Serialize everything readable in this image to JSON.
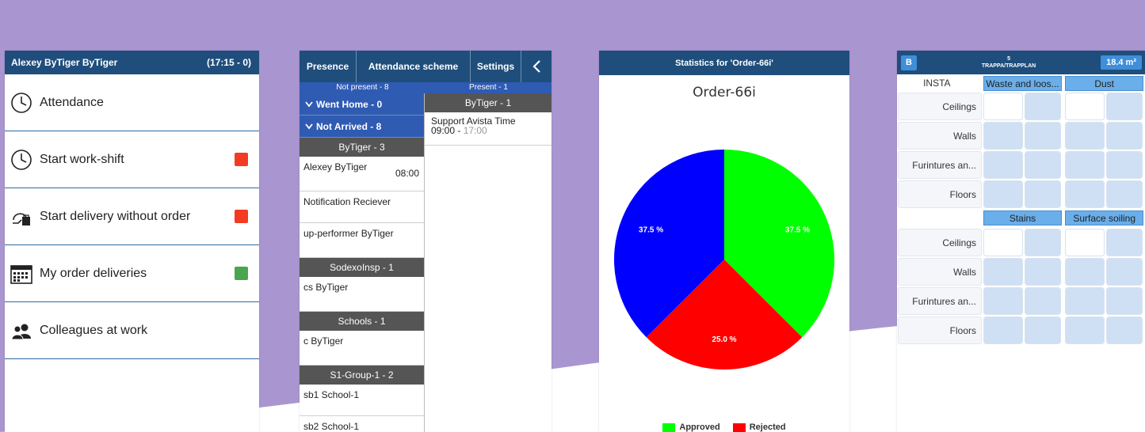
{
  "colors": {
    "header": "#1f4e7c",
    "red": "#f23b22",
    "green": "#4aa64e",
    "blue_group": "#2f5bb3"
  },
  "screen1": {
    "header_name": "Alexey ByTiger ByTiger",
    "header_time": "(17:15 - 0)",
    "items": [
      {
        "label": "Attendance",
        "icon": "clock-icon",
        "status": null
      },
      {
        "label": "Start work-shift",
        "icon": "clock-icon",
        "status": "red"
      },
      {
        "label": "Start delivery without order",
        "icon": "delivery-icon",
        "status": "red"
      },
      {
        "label": "My order deliveries",
        "icon": "calendar-icon",
        "status": "green"
      },
      {
        "label": "Colleagues at work",
        "icon": "people-icon",
        "status": null
      }
    ]
  },
  "screen2": {
    "tabs": [
      "Presence",
      "Attendance scheme",
      "Settings"
    ],
    "back_icon": "chevron-left-icon",
    "not_present": "Not present - 8",
    "present": "Present - 1",
    "went_home": "Went Home - 0",
    "not_arrived": "Not Arrived - 8",
    "left_sections": [
      {
        "title": "ByTiger - 3",
        "people": [
          {
            "name": "Alexey ByTiger",
            "time": "08:00"
          },
          {
            "name": "Notification Reciever",
            "time": ""
          },
          {
            "name": "up-performer ByTiger",
            "time": ""
          }
        ]
      },
      {
        "title": "SodexoInsp - 1",
        "people": [
          {
            "name": "cs ByTiger",
            "time": ""
          }
        ]
      },
      {
        "title": "Schools - 1",
        "people": [
          {
            "name": "c ByTiger",
            "time": ""
          }
        ]
      },
      {
        "title": "S1-Group-1 - 2",
        "people": [
          {
            "name": "sb1 School-1",
            "time": ""
          },
          {
            "name": "sb2 School-1",
            "time": ""
          }
        ]
      }
    ],
    "right_section": "ByTiger - 1",
    "right_entry": {
      "name": "Support Avista Time",
      "start": "09:00",
      "sep": " - ",
      "end": "17:00"
    }
  },
  "screen3": {
    "header": "Statistics for 'Order-66i'",
    "title": "Order-66i",
    "legend": [
      {
        "label": "Approved",
        "color": "#00ff00"
      },
      {
        "label": "Rejected",
        "color": "#ff0000"
      }
    ]
  },
  "chart_data": {
    "type": "pie",
    "title": "Order-66i",
    "slices": [
      {
        "label": "Approved",
        "value": 37.5,
        "color": "#00ff00",
        "text": "37.5 %"
      },
      {
        "label": "Rejected",
        "value": 25.0,
        "color": "#ff0000",
        "text": "25.0 %"
      },
      {
        "label": "",
        "value": 37.5,
        "color": "#0000ff",
        "text": "37.5 %"
      }
    ],
    "legend_entries": [
      "Approved",
      "Rejected"
    ],
    "legend_position": "bottom"
  },
  "screen4": {
    "button_b": "B",
    "top_number": "5",
    "top_text": "TRAPPA/TRAPPLAN",
    "area": "18.4 m²",
    "insta": "INSTA",
    "headers1": [
      "Waste and loos...",
      "Dust"
    ],
    "headers2": [
      "Stains",
      "Surface soiling"
    ],
    "rows": [
      "Ceilings",
      "Walls",
      "Furintures an...",
      "Floors"
    ]
  }
}
